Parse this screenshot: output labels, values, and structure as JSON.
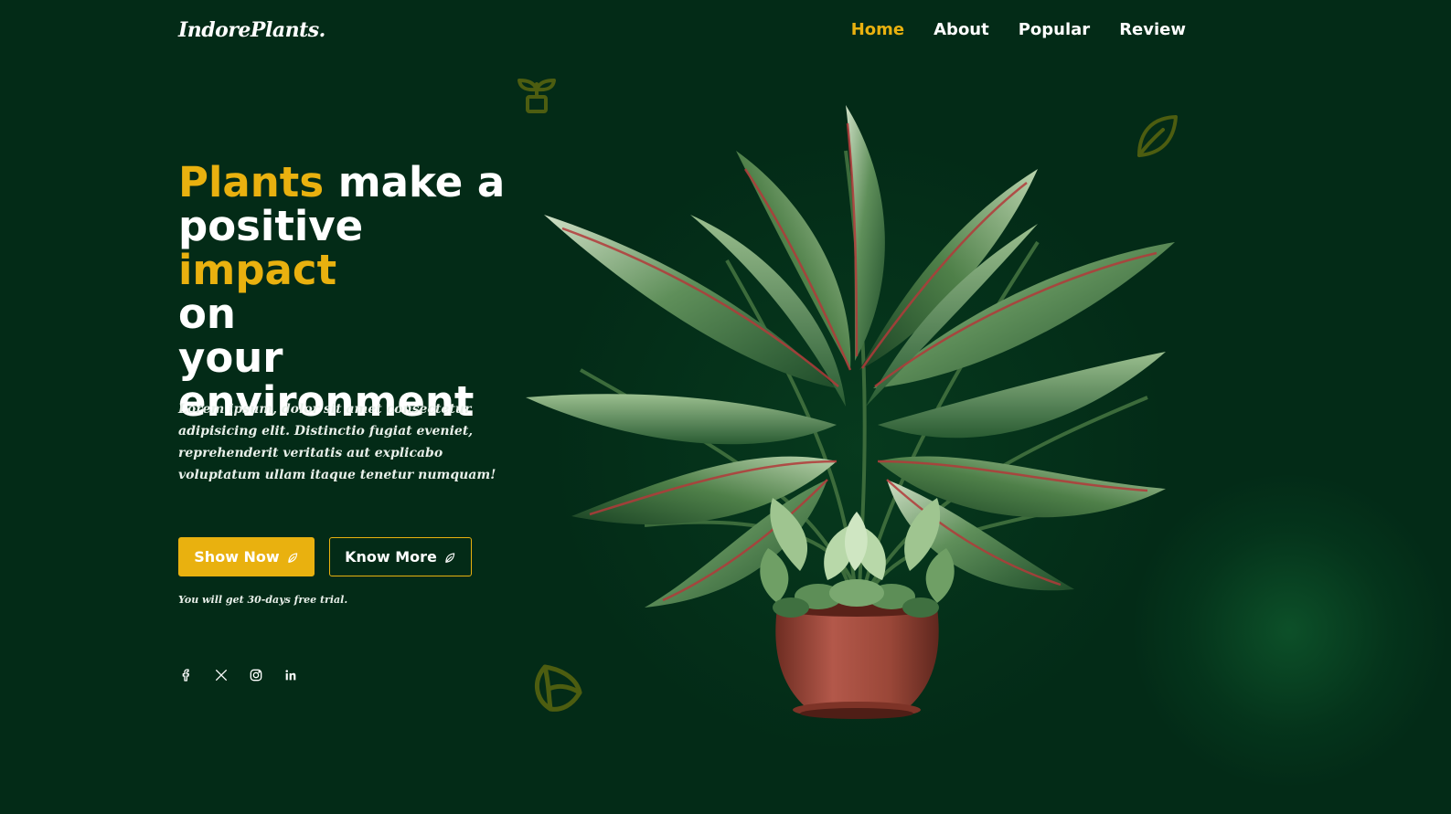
{
  "header": {
    "logo": "IndorePlants.",
    "nav": [
      {
        "label": "Home",
        "active": true
      },
      {
        "label": "About",
        "active": false
      },
      {
        "label": "Popular",
        "active": false
      },
      {
        "label": "Review",
        "active": false
      }
    ]
  },
  "hero": {
    "title_parts": {
      "w1": "Plants",
      "w2": " make a",
      "w3": "positive ",
      "w4": "impact",
      "w5": "on",
      "w6": "your",
      "w7": "environment"
    },
    "description": "Lorem ipsum, dolor sit amet consectetur adipisicing elit. Distinctio fugiat eveniet, reprehenderit veritatis aut explicabo voluptatum ullam itaque tenetur numquam!",
    "buttons": {
      "primary": "Show Now",
      "secondary": "Know More"
    },
    "trial_note": "You will get 30-days free trial."
  },
  "social": [
    "facebook-icon",
    "x-twitter-icon",
    "instagram-icon",
    "linkedin-icon"
  ],
  "colors": {
    "background": "#032b17",
    "accent": "#e9b10f",
    "text": "#ffffff",
    "deco_icon": "#4d5d10"
  },
  "illustration": "potted-plant"
}
